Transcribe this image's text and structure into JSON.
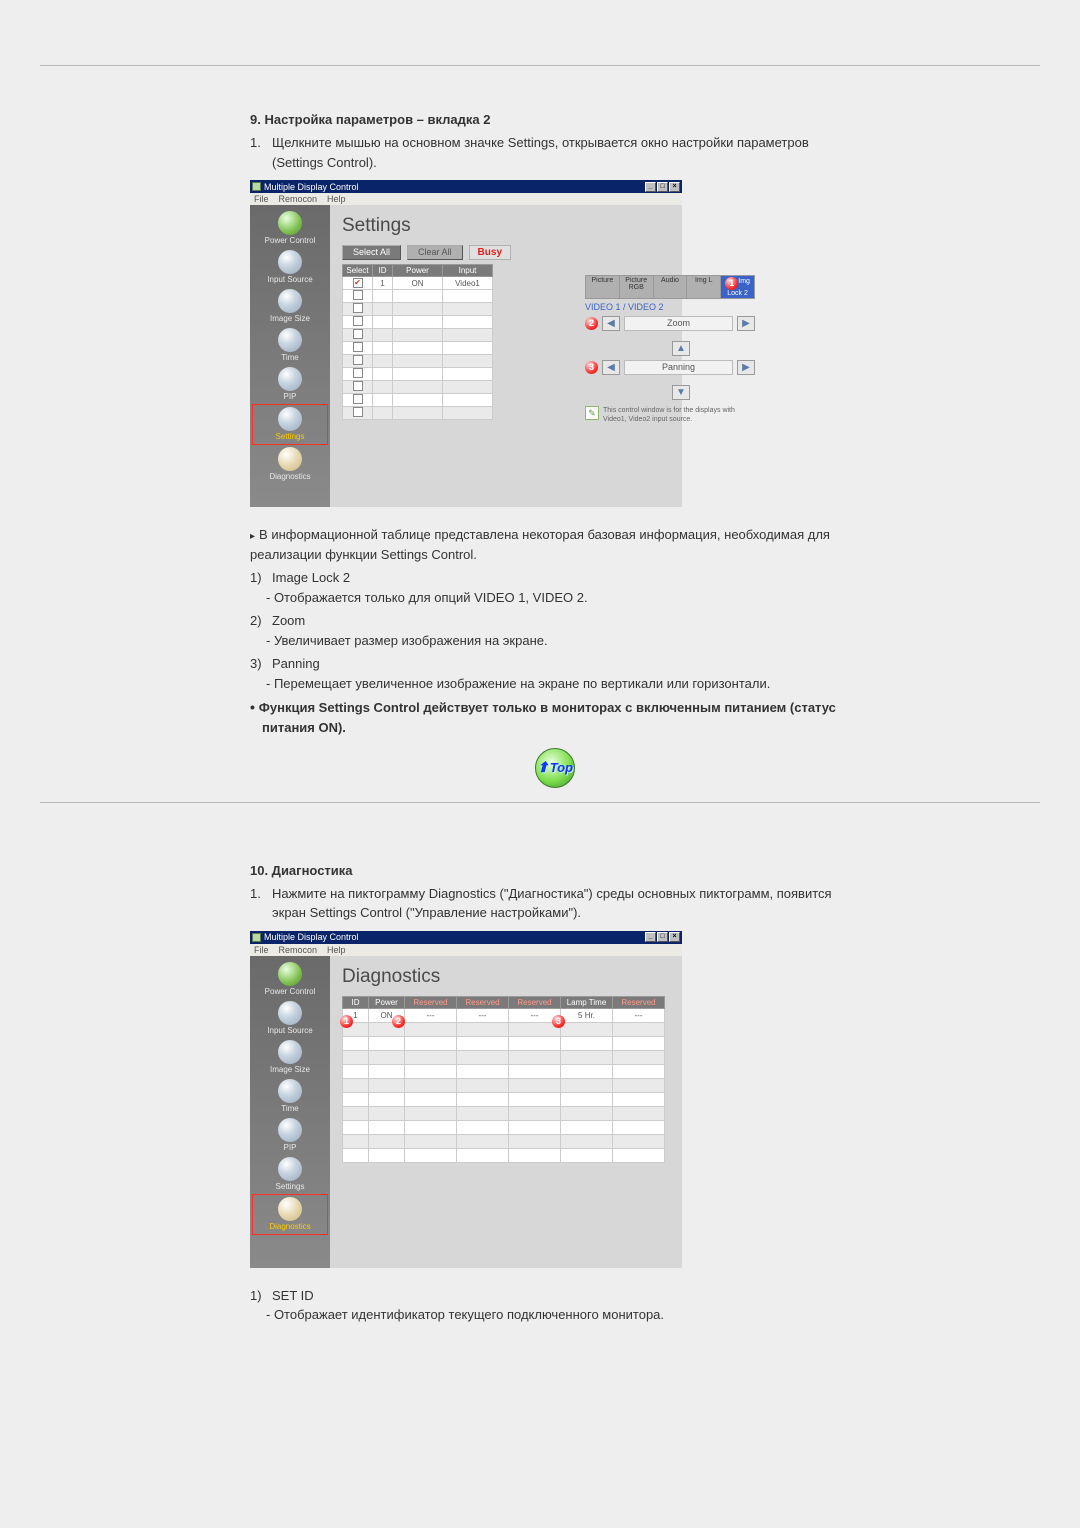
{
  "section9": {
    "heading": "9. Настройка параметров – вкладка 2",
    "step_num": "1.",
    "step_text": "Щелкните мышью на основном значке Settings, открывается окно настройки параметров (Settings Control).",
    "app": {
      "title": "Multiple Display Control",
      "menu": [
        "File",
        "Remocon",
        "Help"
      ],
      "panel_title": "Settings",
      "sidebar": [
        {
          "label": "Power Control"
        },
        {
          "label": "Input Source"
        },
        {
          "label": "Image Size"
        },
        {
          "label": "Time"
        },
        {
          "label": "PIP"
        },
        {
          "label": "Settings"
        },
        {
          "label": "Diagnostics"
        }
      ],
      "buttons": {
        "select_all": "Select All",
        "clear_all": "Clear All",
        "busy": "Busy"
      },
      "table": {
        "headers": [
          "Select",
          "ID",
          "Power",
          "Input"
        ],
        "row1": {
          "select": "☑",
          "id": "1",
          "power": "ON",
          "input": "Video1"
        }
      },
      "tabs": [
        "Picture",
        "Picture RGB",
        "Audio",
        "Img L",
        "Img Lock 2"
      ],
      "video_label": "VIDEO 1 / VIDEO 2",
      "zoom": "Zoom",
      "panning": "Panning",
      "note": "This control window is for the displays with Video1, Video2 input source."
    },
    "bullets": {
      "info": "В информационной таблице представлена некоторая базовая информация, необходимая для реализации функции Settings Control.",
      "b1_num": "1)",
      "b1_title": "Image Lock 2",
      "b1_text": "- Отображается только для опций VIDEO 1, VIDEO 2.",
      "b2_num": "2)",
      "b2_title": "Zoom",
      "b2_text": "- Увеличивает размер изображения на экране.",
      "b3_num": "3)",
      "b3_title": "Panning",
      "b3_text": "- Перемещает увеличенное изображение на экране по вертикали или горизонтали.",
      "warn": "Функция Settings Control действует только в мониторах с включенным питанием (статус питания ON)."
    }
  },
  "top_button": "Top",
  "section10": {
    "heading": "10. Диагностика",
    "step_num": "1.",
    "step_text": "Нажмите на пиктограмму Diagnostics (\"Диагностика\") среды основных пиктограмм, появится экран Settings Control (\"Управление настройками\").",
    "app": {
      "title": "Multiple Display Control",
      "menu": [
        "File",
        "Remocon",
        "Help"
      ],
      "panel_title": "Diagnostics",
      "sidebar": [
        {
          "label": "Power Control"
        },
        {
          "label": "Input Source"
        },
        {
          "label": "Image Size"
        },
        {
          "label": "Time"
        },
        {
          "label": "PIP"
        },
        {
          "label": "Settings"
        },
        {
          "label": "Diagnostics"
        }
      ],
      "headers": [
        "ID",
        "Power",
        "Reserved",
        "Reserved",
        "Reserved",
        "Lamp Time",
        "Reserved"
      ],
      "row1": {
        "id": "1",
        "power": "ON",
        "c3": "---",
        "c4": "---",
        "c5": "---",
        "lamp": "5 Hr.",
        "c7": "---"
      }
    },
    "bullets": {
      "b1_num": "1)",
      "b1_title": "SET ID",
      "b1_text": "- Отображает идентификатор текущего подключенного монитора."
    }
  }
}
